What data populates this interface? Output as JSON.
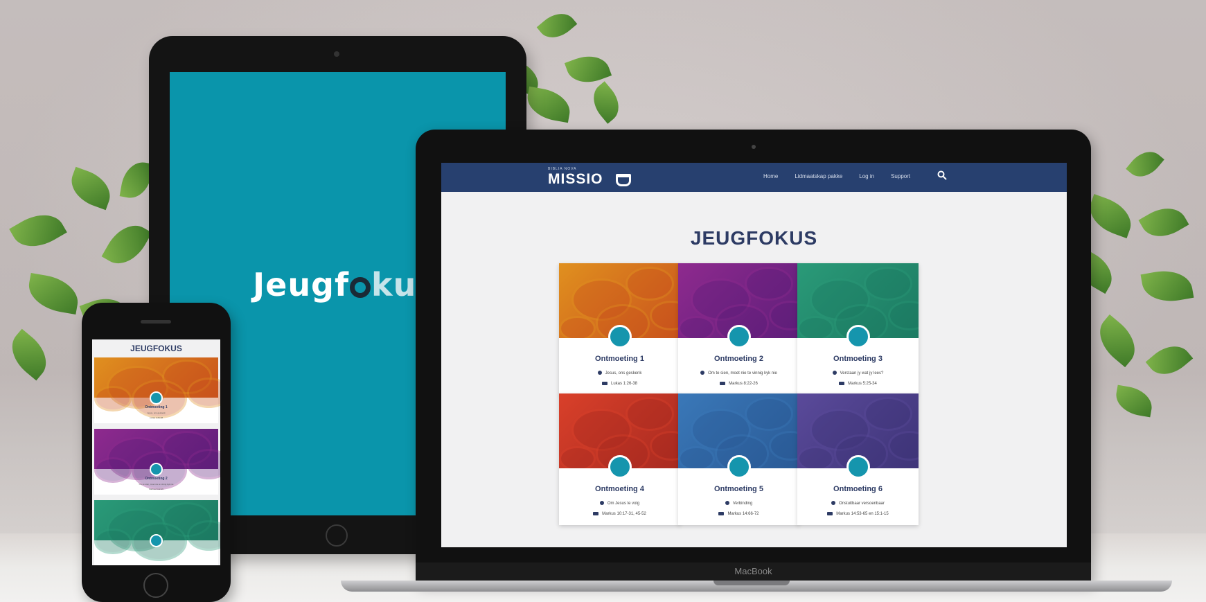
{
  "tablet": {
    "logo_part1": "Jeugf",
    "logo_part2": "kus"
  },
  "laptop": {
    "brand_label": "MacBook",
    "nav": {
      "brand_small": "BIBLIA NOVA",
      "brand_main": "MISSIO",
      "links": [
        "Home",
        "Lidmaatskap pakke",
        "Log in",
        "Support"
      ]
    },
    "page_title": "JEUGFOKUS",
    "cards": [
      {
        "title": "Ontmoeting 1",
        "theme": "Jesus, ons geskenk",
        "reference": "Lukas 1:26-38",
        "color1": "#e0901f",
        "color2": "#c9521c"
      },
      {
        "title": "Ontmoeting 2",
        "theme": "Om te sien, moet nie te vinnig kyk nie",
        "reference": "Markus 8:22-26",
        "color1": "#8e2a8e",
        "color2": "#5e1e7a"
      },
      {
        "title": "Ontmoeting 3",
        "theme": "Verstaan jy wat jy lees?",
        "reference": "Markus 5:25-34",
        "color1": "#2a9a78",
        "color2": "#1c7a62"
      },
      {
        "title": "Ontmoeting 4",
        "theme": "Om Jesus te volg",
        "reference": "Markus 10:17-31, 45-52",
        "color1": "#d9402a",
        "color2": "#a82a20"
      },
      {
        "title": "Ontmoeting 5",
        "theme": "Verbinding",
        "reference": "Markus 14:66-72",
        "color1": "#3a78b8",
        "color2": "#2a5a96"
      },
      {
        "title": "Ontmoeting 6",
        "theme": "Onstuitbaar versoenbaar",
        "reference": "Markus 14:53-65 en 15:1-15",
        "color1": "#5a4a9a",
        "color2": "#3e3478"
      }
    ]
  },
  "phone": {
    "page_title": "JEUGFOKUS",
    "cards": [
      {
        "title": "Ontmoeting 1",
        "theme": "Jesus, ons geskenk",
        "reference": "Lukas 1:26-38",
        "color1": "#e0901f",
        "color2": "#c9521c"
      },
      {
        "title": "Ontmoeting 2",
        "theme": "Om te sien, moet nie te vinnig kyk nie",
        "reference": "Markus 8:22-26",
        "color1": "#8e2a8e",
        "color2": "#5e1e7a"
      },
      {
        "title": "",
        "theme": "",
        "reference": "",
        "color1": "#2a9a78",
        "color2": "#1c7a62"
      }
    ]
  }
}
